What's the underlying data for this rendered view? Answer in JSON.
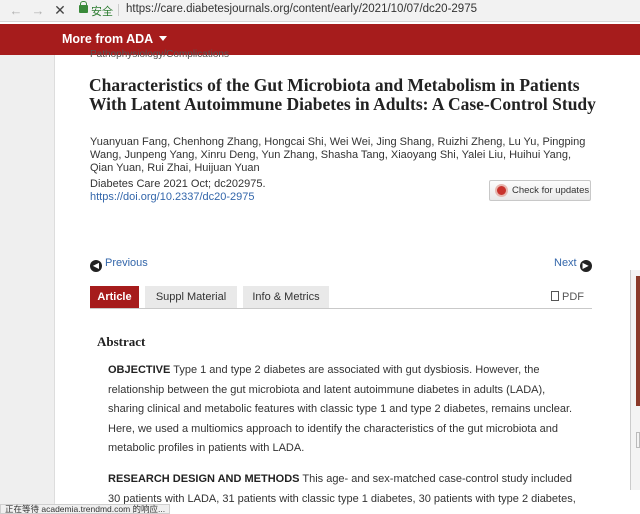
{
  "browser": {
    "secure_label": "安全",
    "url": "https://care.diabetesjournals.org/content/early/2021/10/07/dc20-2975",
    "back_icon": "arrow-left-icon",
    "forward_icon": "arrow-right-icon",
    "stop_icon": "close-icon"
  },
  "sitebar": {
    "more_label": "More from ADA"
  },
  "article": {
    "category": "Pathophysiology/Complications",
    "title": "Characteristics of the Gut Microbiota and Metabolism in Patients With Latent Autoimmune Diabetes in Adults: A Case-Control Study",
    "authors": "Yuanyuan Fang, Chenhong Zhang, Hongcai Shi, Wei Wei, Jing Shang, Ruizhi Zheng, Lu Yu, Pingping Wang, Junpeng Yang, Xinru Deng, Yun Zhang, Shasha Tang, Xiaoyang Shi, Yalei Liu, Huihui Yang, Qian Yuan, Rui Zhai, Huijuan Yuan",
    "citation": "Diabetes Care 2021 Oct; dc202975.",
    "doi": "https://doi.org/10.2337/dc20-2975",
    "updates_label": "Check for updates"
  },
  "pager": {
    "previous": "Previous",
    "next": "Next"
  },
  "tabs": [
    {
      "label": "Article"
    },
    {
      "label": "Suppl Material"
    },
    {
      "label": "Info & Metrics"
    }
  ],
  "pdf_label": "PDF",
  "abstract": {
    "heading": "Abstract",
    "objective_label": "OBJECTIVE",
    "objective_text": "Type 1 and type 2 diabetes are associated with gut dysbiosis. However, the relationship between the gut microbiota and latent autoimmune diabetes in adults (LADA), sharing clinical and metabolic features with classic type 1 and type 2 diabetes, remains unclear. Here, we used a multiomics approach to identify the characteristics of the gut microbiota and metabolic profiles in patients with LADA.",
    "methods_label": "RESEARCH DESIGN AND METHODS",
    "methods_text": "This age- and sex-matched case-control study included 30 patients with LADA, 31 patients with classic type 1 diabetes, 30 patients with type 2 diabetes,"
  },
  "status_text": "正在等待 academia.trendmd.com 的响应...",
  "colors": {
    "brand_red": "#a61c1c",
    "link_blue": "#3366aa"
  }
}
